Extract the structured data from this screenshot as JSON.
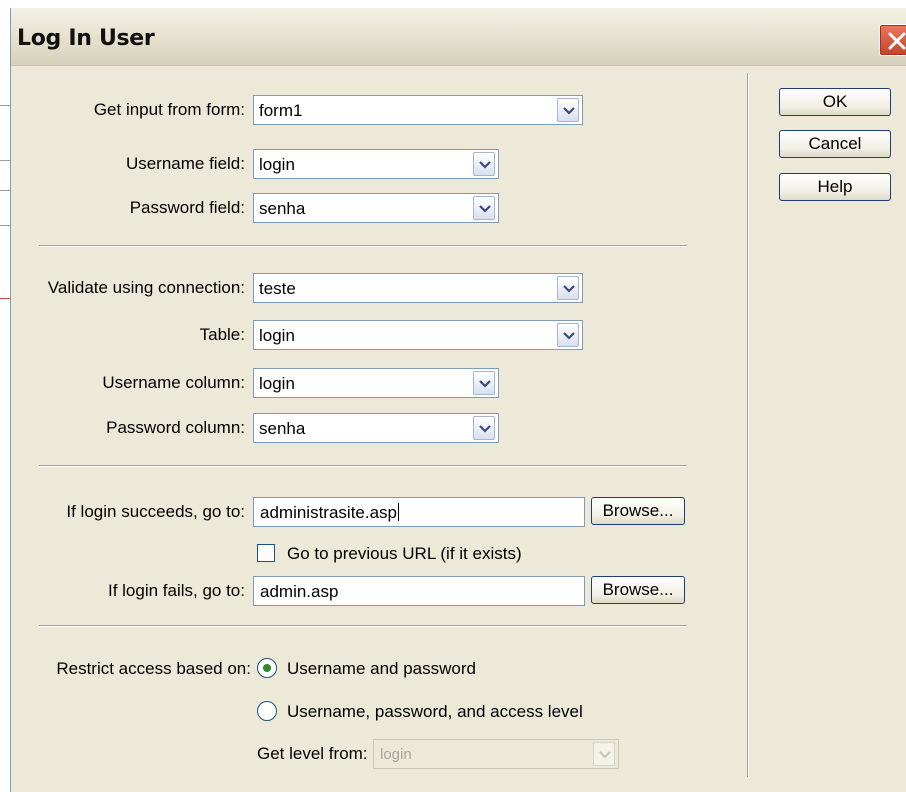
{
  "window": {
    "title": "Log In User"
  },
  "buttons": {
    "ok": "OK",
    "cancel": "Cancel",
    "help": "Help"
  },
  "form": {
    "get_input_label": "Get input from form:",
    "get_input_value": "form1",
    "username_field_label": "Username field:",
    "username_field_value": "login",
    "password_field_label": "Password field:",
    "password_field_value": "senha"
  },
  "validation": {
    "connection_label": "Validate using connection:",
    "connection_value": "teste",
    "table_label": "Table:",
    "table_value": "login",
    "username_column_label": "Username column:",
    "username_column_value": "login",
    "password_column_label": "Password column:",
    "password_column_value": "senha"
  },
  "redirects": {
    "success_label": "If login succeeds, go to:",
    "success_value": "administrasite.asp",
    "browse_label": "Browse...",
    "previous_url_label": "Go to previous URL (if it exists)",
    "previous_url_checked": false,
    "fail_label": "If login fails, go to:",
    "fail_value": "admin.asp"
  },
  "access": {
    "restrict_label": "Restrict access based on:",
    "option_1": "Username and password",
    "option_2": "Username, password, and access level",
    "selected_option": 1,
    "level_label": "Get level from:",
    "level_value": "login"
  }
}
